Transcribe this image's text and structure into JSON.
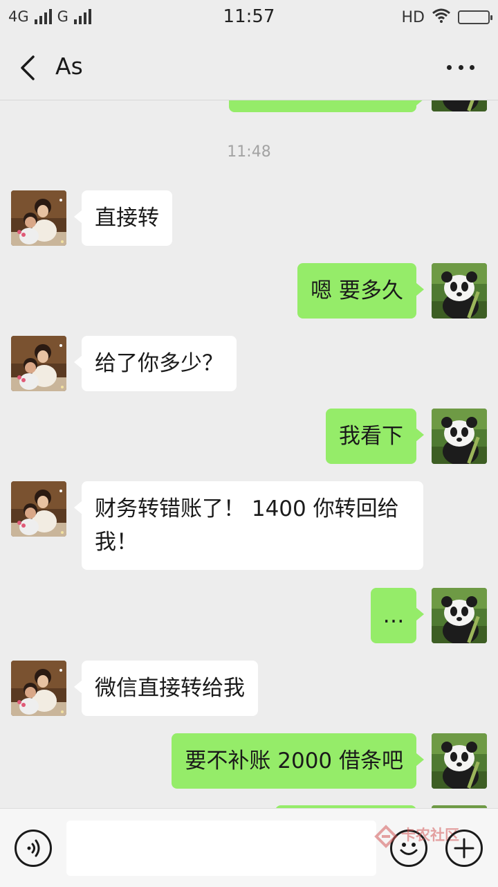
{
  "status_bar": {
    "network1": "4G",
    "network2": "G",
    "time": "11:57",
    "hd": "HD",
    "wifi_icon": "wifi-icon",
    "battery_icon": "battery-icon"
  },
  "header": {
    "title": "As",
    "back_icon": "chevron-left-icon",
    "more_icon": "more-dots-icon"
  },
  "chat": {
    "timestamp": "11:48",
    "messages": [
      {
        "side": "in",
        "text": "直接转"
      },
      {
        "side": "out",
        "text": "嗯 要多久"
      },
      {
        "side": "in",
        "text": "给了你多少？"
      },
      {
        "side": "out",
        "text": "我看下"
      },
      {
        "side": "in",
        "text": "财务转错账了！ 1400 你转回给我！"
      },
      {
        "side": "out",
        "text": "…"
      },
      {
        "side": "in",
        "text": "微信直接转给我"
      },
      {
        "side": "out",
        "text": "要不补账 2000 借条吧"
      }
    ]
  },
  "input_bar": {
    "text_value": "",
    "voice_icon": "voice-icon",
    "emoji_icon": "emoji-icon",
    "plus_icon": "plus-icon",
    "watermark_text": "卡农社区"
  },
  "colors": {
    "background": "#ededed",
    "outgoing_bubble": "#95ec69",
    "incoming_bubble": "#ffffff"
  }
}
